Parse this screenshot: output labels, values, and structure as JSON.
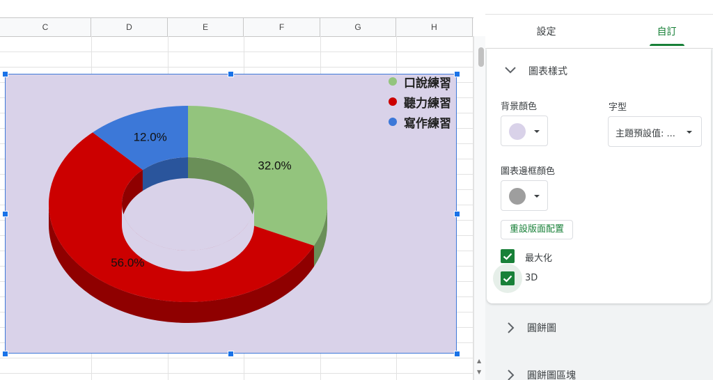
{
  "sheet": {
    "columns": [
      "C",
      "D",
      "E",
      "F",
      "G",
      "H"
    ]
  },
  "chart_data": {
    "type": "pie",
    "variant": "3d-donut",
    "title": "",
    "slices": [
      {
        "label": "口說練習",
        "value": 32.0,
        "display": "32.0%",
        "color": "#93c47d",
        "side_color": "#6a8f58"
      },
      {
        "label": "聽力練習",
        "value": 56.0,
        "display": "56.0%",
        "color": "#cc0000",
        "side_color": "#8f0000"
      },
      {
        "label": "寫作練習",
        "value": 12.0,
        "display": "12.0%",
        "color": "#3c78d8",
        "side_color": "#2a559c"
      }
    ],
    "background": "#d9d2e9",
    "legend_position": "top-right"
  },
  "panel": {
    "tabs": [
      {
        "label": "設定",
        "active": false
      },
      {
        "label": "自訂",
        "active": true
      }
    ],
    "chart_style": {
      "title": "圖表樣式",
      "background_color_label": "背景顏色",
      "background_color": "#d9d2e9",
      "font_label": "字型",
      "font_value": "主題預設值: ...",
      "border_color_label": "圖表邊框顏色",
      "border_color": "#9e9e9e",
      "reset_layout": "重設版面配置",
      "maximize_label": "最大化",
      "maximize_checked": true,
      "three_d_label": "3D",
      "three_d_checked": true
    },
    "sections": [
      {
        "label": "圓餅圖"
      },
      {
        "label": "圓餅圖區塊"
      }
    ],
    "accent": "#188038"
  }
}
